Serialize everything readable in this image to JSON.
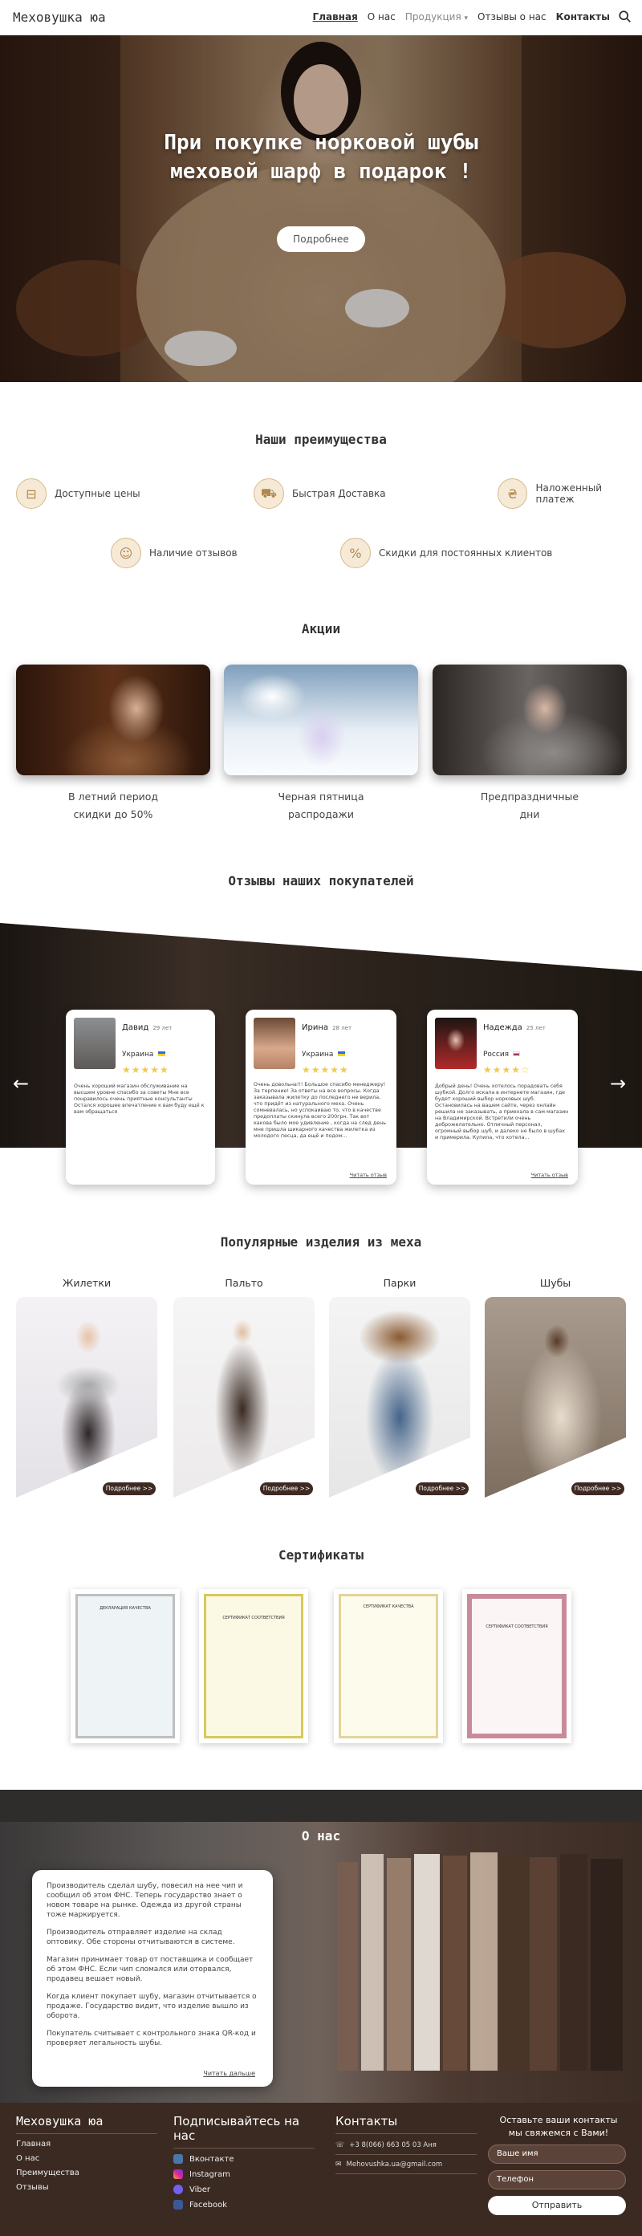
{
  "header": {
    "logo": "Меховушка юа",
    "nav": [
      "Главная",
      "О нас",
      "Продукция",
      "Отзывы о нас",
      "Контакты"
    ],
    "products_caret": "▾"
  },
  "hero": {
    "title_line1": "При покупке норковой шубы",
    "title_line2": "меховой шарф в подарок !",
    "button": "Подробнее"
  },
  "advantages": {
    "title": "Наши преимущества",
    "items": [
      "Доступные цены",
      "Быстрая Доставка",
      "Наложенный платеж",
      "Наличие отзывов",
      "Скидки для постоянных клиентов"
    ]
  },
  "promotions": {
    "title": "Акции",
    "items": [
      {
        "line1": "В летний период",
        "line2": "скидки до 50%"
      },
      {
        "line1": "Черная пятница",
        "line2": "распродажи"
      },
      {
        "line1": "Предпраздничные",
        "line2": "дни"
      }
    ]
  },
  "reviews": {
    "title": "Отзывы наших покупателей",
    "more": "Читать отзыв",
    "items": [
      {
        "name": "Давид",
        "age": "29 лет",
        "country": "Украина",
        "stars": "★★★★★",
        "text": "Очень хороший магазин обслуживание на высшем уровне спасибо за советы Мне все понравилось очень приятные консультанты Остался хорошее впечатление к вам буду ещё к вам обращаться"
      },
      {
        "name": "Ирина",
        "age": "28 лет",
        "country": "Украина",
        "stars": "★★★★★",
        "text": "Очень довольна!!! Большое спасибо менеджеру! За терпение! За ответы на все вопросы. Когда заказывала жилетку до последнего не верила, что придёт из натурального меха. Очень сомневалась, но успокаиваю то, что в качестве предоплаты скинула всего 200грн. Так вот какова было мое удивление , когда на след день мне пришла шикарного качества жилетка из молодого песца, да ещё и подом..."
      },
      {
        "name": "Надежда",
        "age": "25 лет",
        "country": "Россия",
        "stars": "★★★★☆",
        "text": "Добрый день! Очень хотелось порадовать себя шубкой. Долго искала в интернете магазин, где будет хороший выбор норковых шуб. Остановилась на вашем сайте, через онлайн решила не заказывать, а приехала в сам магазин на Владимирской. Встретили очень доброжелательно. Отличный персонал, огромный выбор шуб, и далеко не было в шубах и примерила. Купила, что хотела..."
      }
    ]
  },
  "products": {
    "title": "Популярные изделия из меха",
    "button": "Подробнее >>",
    "items": [
      "Жилетки",
      "Пальто",
      "Парки",
      "Шубы"
    ]
  },
  "certificates": {
    "title": "Сертификаты",
    "items": [
      "ДЕКЛАРАЦИЯ КАЧЕСТВА",
      "СЕРТИФИКАТ СООТВЕТСТВИЯ",
      "СЕРТИФИКАТ КАЧЕСТВА",
      "СЕРТИФИКАТ СООТВЕТСТВИЯ"
    ]
  },
  "about": {
    "title": "О нас",
    "paragraphs": [
      "Производитель сделал шубу, повесил на нее чип и сообщил об этом ФНС. Теперь государство знает о новом товаре на рынке. Одежда из другой страны тоже маркируется.",
      "Производитель отправляет изделие на склад оптовику. Обе стороны отчитываются в системе.",
      "Магазин принимает товар от поставщика и сообщает об этом ФНС. Если чип сломался или оторвался, продавец вешает новый.",
      "Когда клиент покупает шубу, магазин отчитывается о продаже. Государство видит, что изделие вышло из оборота.",
      "Покупатель считывает с контрольного знака QR-код и проверяет легальность шубы."
    ],
    "more": "Читать дальше"
  },
  "footer": {
    "logo": "Меховушка юа",
    "links": [
      "Главная",
      "О нас",
      "Преимущества",
      "Отзывы"
    ],
    "subscribe_title": "Подписывайтесь на нас",
    "socials": [
      "Вконтакте",
      "Instagram",
      "Viber",
      "Facebook"
    ],
    "contacts_title": "Контакты",
    "phone": "+3 8(066) 663 05 03  Аня",
    "email": "Mehovushka.ua@gmail.com",
    "form_title_line1": "Оставьте ваши контакты",
    "form_title_line2": "мы свяжемся с Вами!",
    "name_placeholder": "Ваше имя",
    "phone_placeholder": "Телефон",
    "submit": "Отправить"
  },
  "colors": {
    "brand_dark": "#3b2a22",
    "accent_gold": "#d8b98a",
    "star": "#f2c94c"
  }
}
